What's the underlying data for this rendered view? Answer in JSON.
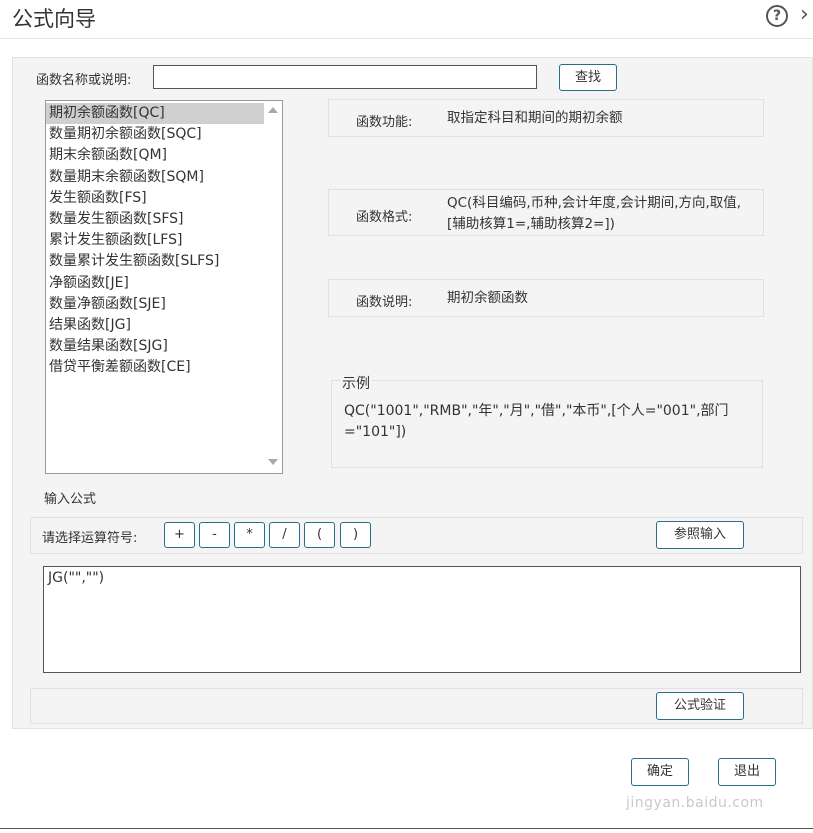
{
  "window": {
    "title": "公式向导",
    "help_icon": "?",
    "close_icon": "›"
  },
  "search": {
    "label": "函数名称或说明:",
    "value": "",
    "find_button": "查找"
  },
  "function_list": {
    "selected_index": 0,
    "items": [
      "期初余额函数[QC]",
      "数量期初余额函数[SQC]",
      "期末余额函数[QM]",
      "数量期末余额函数[SQM]",
      "发生额函数[FS]",
      "数量发生额函数[SFS]",
      "累计发生额函数[LFS]",
      "数量累计发生额函数[SLFS]",
      "净额函数[JE]",
      "数量净额函数[SJE]",
      "结果函数[JG]",
      "数量结果函数[SJG]",
      "借贷平衡差额函数[CE]"
    ]
  },
  "info": {
    "function_label": "函数功能:",
    "function_value": "取指定科目和期间的期初余额",
    "format_label": "函数格式:",
    "format_value": "QC(科目编码,币种,会计年度,会计期间,方向,取值,[辅助核算1=,辅助核算2=])",
    "desc_label": "函数说明:",
    "desc_value": "期初余额函数"
  },
  "example": {
    "legend": "示例",
    "code": "QC(\"1001\",\"RMB\",\"年\",\"月\",\"借\",\"本币\",[个人=\"001\",部门=\"101\"])"
  },
  "formula_section": {
    "label": "输入公式",
    "operator_label": "请选择运算符号:",
    "operators": [
      "+",
      "-",
      "*",
      "/",
      "(",
      ")"
    ],
    "reference_button": "参照输入",
    "value": "JG(\"\",\"\")",
    "verify_button": "公式验证"
  },
  "footer": {
    "ok_button": "确定",
    "exit_button": "退出"
  },
  "watermark": "jingyan.baidu.com"
}
